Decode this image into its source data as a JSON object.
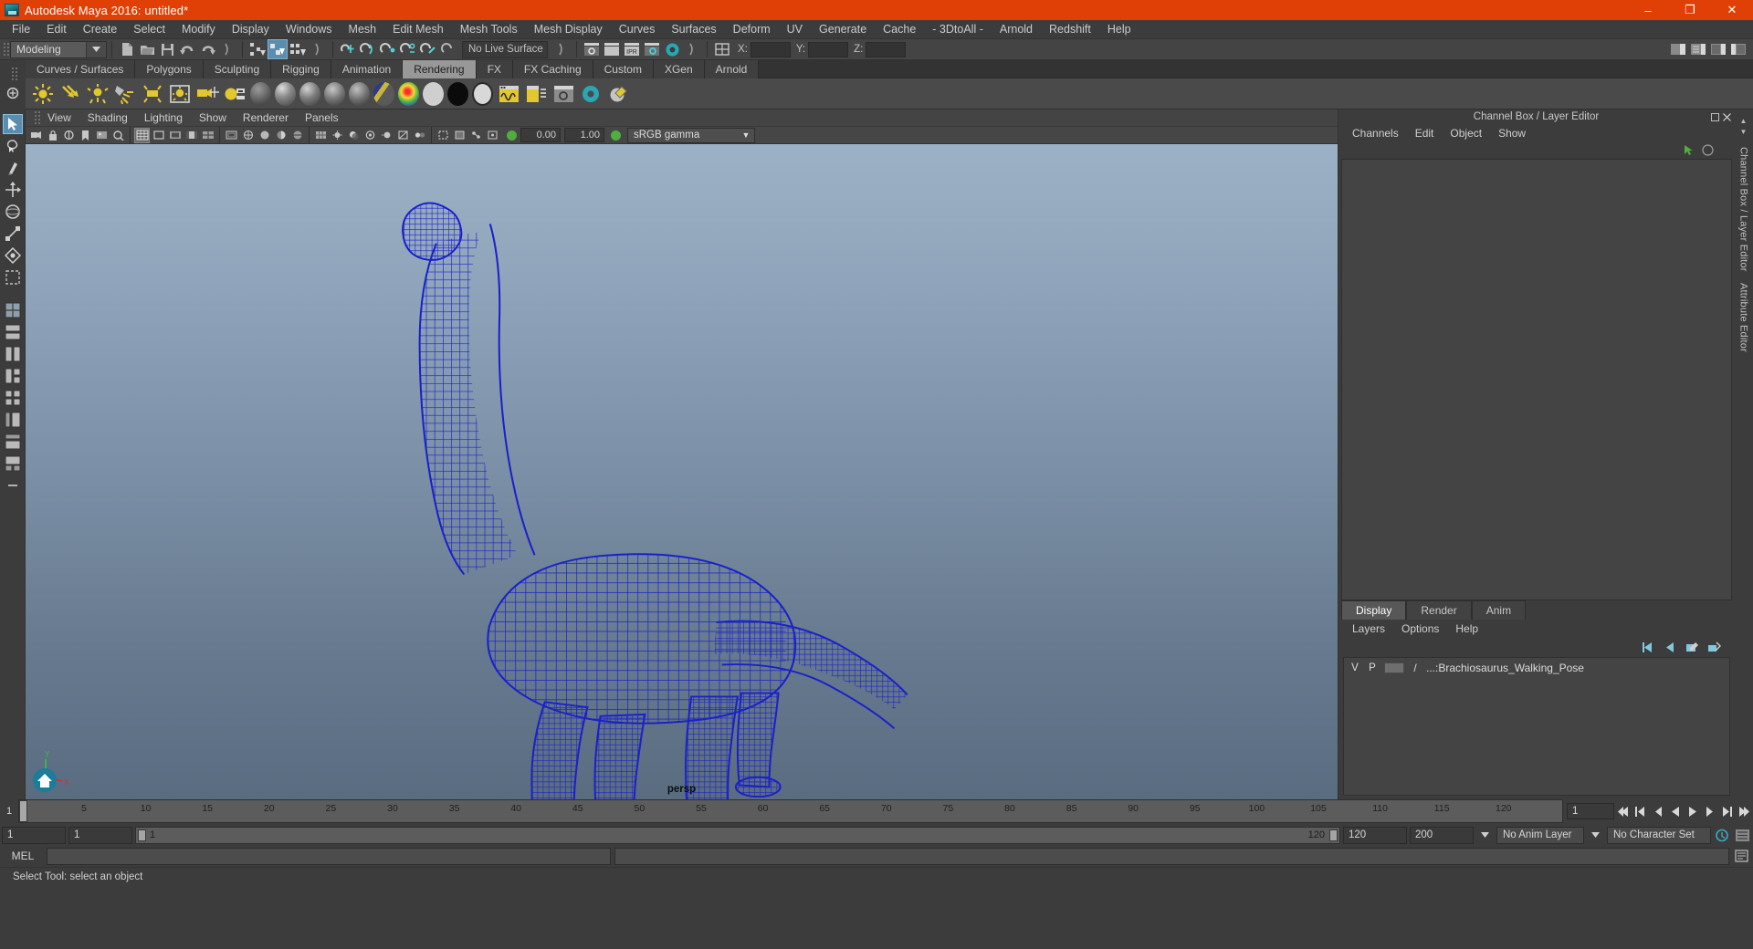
{
  "window": {
    "title": "Autodesk Maya 2016: untitled*",
    "app_icon": "maya-logo-icon",
    "minimize": "–",
    "maximize": "❐",
    "close": "✕",
    "titlebar_color": "#e04006"
  },
  "menubar": {
    "items": [
      "File",
      "Edit",
      "Create",
      "Select",
      "Modify",
      "Display",
      "Windows",
      "Mesh",
      "Edit Mesh",
      "Mesh Tools",
      "Mesh Display",
      "Curves",
      "Surfaces",
      "Deform",
      "UV",
      "Generate",
      "Cache",
      "- 3DtoAll -",
      "Arnold",
      "Redshift",
      "Help"
    ]
  },
  "toolbar": {
    "menuset": "Modeling",
    "live_surface": "No Live Surface",
    "coord_x_label": "X:",
    "coord_y_label": "Y:",
    "coord_z_label": "Z:",
    "coord_x_value": "",
    "coord_y_value": "",
    "coord_z_value": "",
    "icons": [
      "new-scene-icon",
      "open-scene-icon",
      "save-scene-icon",
      "undo-icon",
      "redo-icon",
      "select-by-hierarchy-icon",
      "select-by-object-icon",
      "select-by-component-icon",
      "snap-to-grid-icon",
      "snap-to-curve-icon",
      "snap-to-point-icon",
      "snap-to-projected-center-icon",
      "snap-to-view-plane-icon",
      "make-live-icon",
      "render-view-icon",
      "render-current-frame-icon",
      "ipr-render-icon",
      "render-settings-icon",
      "hypershade-icon",
      "editor-toggle-icon"
    ],
    "ipr_label": "IPR"
  },
  "shelf": {
    "tabs": [
      "Curves / Surfaces",
      "Polygons",
      "Sculpting",
      "Rigging",
      "Animation",
      "Rendering",
      "FX",
      "FX Caching",
      "Custom",
      "XGen",
      "Arnold"
    ],
    "active_tab": "Rendering",
    "icons": [
      "ambient-light-icon",
      "directional-light-icon",
      "point-light-icon",
      "spot-light-icon",
      "area-light-icon",
      "volume-light-icon",
      "create-camera-icon",
      "image-plane-icon",
      "lambert-material-icon",
      "blinn-material-icon",
      "phong-material-icon",
      "phonge-material-icon",
      "anisotropic-material-icon",
      "layered-shader-icon",
      "ramp-shader-icon",
      "surface-shader-icon",
      "use-background-icon",
      "shading-map-icon",
      "render-view-window-icon",
      "batch-render-icon",
      "render-settings-shelf-icon",
      "hypershade-shelf-icon",
      "toon-shader-icon"
    ]
  },
  "left_toolbox": {
    "items": [
      "select-tool-icon",
      "lasso-select-tool-icon",
      "paint-select-tool-icon",
      "move-tool-icon",
      "rotate-tool-icon",
      "scale-tool-icon",
      "soft-select-icon",
      "last-tool-icon",
      "single-pane-layout-icon",
      "two-pane-split-vertical-icon",
      "two-pane-split-horizontal-icon",
      "three-pane-layout-icon",
      "four-pane-layout-icon",
      "outliner-persp-layout-icon",
      "hypershade-persp-layout-icon",
      "persp-graph-layout-icon",
      "more-layouts-icon"
    ],
    "selected": "select-tool-icon"
  },
  "viewport": {
    "menus": [
      "View",
      "Shading",
      "Lighting",
      "Show",
      "Renderer",
      "Panels"
    ],
    "camera_label": "persp",
    "exposure_value": "0.00",
    "gamma_value": "1.00",
    "color_profile": "sRGB gamma",
    "toolbar_icons": [
      "select-camera-icon",
      "lock-camera-icon",
      "camera-attributes-icon",
      "bookmark-icon",
      "image-plane-icon",
      "2d-pan-zoom-icon",
      "grid-toggle-icon",
      "film-gate-icon",
      "resolution-gate-icon",
      "gate-mask-icon",
      "film-origin-icon",
      "safe-action-icon",
      "safe-title-icon",
      "wireframe-shading-icon",
      "smooth-shade-all-icon",
      "smooth-shade-selected-icon",
      "flat-shade-icon",
      "wireframe-on-shaded-icon",
      "textured-icon",
      "use-all-lights-icon",
      "shadows-icon",
      "screen-space-ao-icon",
      "motion-blur-icon",
      "multisample-aa-icon",
      "depth-of-field-icon",
      "isolate-select-icon",
      "xray-icon",
      "xray-joints-icon",
      "xray-active-components-icon",
      "exposure-icon",
      "gamma-icon"
    ],
    "model_name": "Brachiosaurus wireframe",
    "wireframe_color": "#1a21c9",
    "background_top": "#9db1c6",
    "background_bottom": "#5a6c80",
    "axis_labels": {
      "y": "Y",
      "x": "X",
      "z": "Z"
    }
  },
  "channelbox": {
    "panel_title": "Channel Box / Layer Editor",
    "menus": [
      "Channels",
      "Edit",
      "Object",
      "Show"
    ],
    "vertical_tabs": [
      "Channel Box / Layer Editor",
      "Attribute Editor"
    ],
    "content": ""
  },
  "layer_editor": {
    "tabs": [
      "Display",
      "Render",
      "Anim"
    ],
    "active_tab": "Display",
    "menus": [
      "Layers",
      "Options",
      "Help"
    ],
    "tool_icons": [
      "layer-move-left-icon",
      "layer-move-right-icon",
      "new-layer-icon",
      "new-layer-from-selected-icon"
    ],
    "columns": {
      "v": "V",
      "p": "P"
    },
    "layers": [
      {
        "v": "V",
        "p": "P",
        "color_swatch": "#6e6e6e",
        "name": "...:Brachiosaurus_Walking_Pose"
      }
    ]
  },
  "timeline": {
    "start_frame": "1",
    "current_frame": "1",
    "tick_labels": [
      "5",
      "10",
      "15",
      "20",
      "25",
      "30",
      "35",
      "40",
      "45",
      "50",
      "55",
      "60",
      "65",
      "70",
      "75",
      "80",
      "85",
      "90",
      "95",
      "100",
      "105",
      "110",
      "115",
      "120"
    ],
    "frame_field": "1",
    "playback_icons": [
      "go-to-start-icon",
      "step-back-keyframe-icon",
      "step-back-frame-icon",
      "play-backwards-icon",
      "play-forwards-icon",
      "step-forward-frame-icon",
      "step-forward-keyframe-icon",
      "go-to-end-icon"
    ],
    "range_start": "1",
    "range_start2": "1",
    "range_bar_start": "1",
    "range_bar_end": "120",
    "range_end": "120",
    "playback_end": "200",
    "anim_layer": "No Anim Layer",
    "character_set": "No Character Set",
    "auto_keyframe_icon": "auto-keyframe-icon",
    "animation_prefs_icon": "animation-preferences-icon"
  },
  "command_line": {
    "language_label": "MEL",
    "input_value": "",
    "output_value": "",
    "script_editor_icon": "script-editor-icon"
  },
  "status_line": {
    "message": "Select Tool: select an object"
  }
}
